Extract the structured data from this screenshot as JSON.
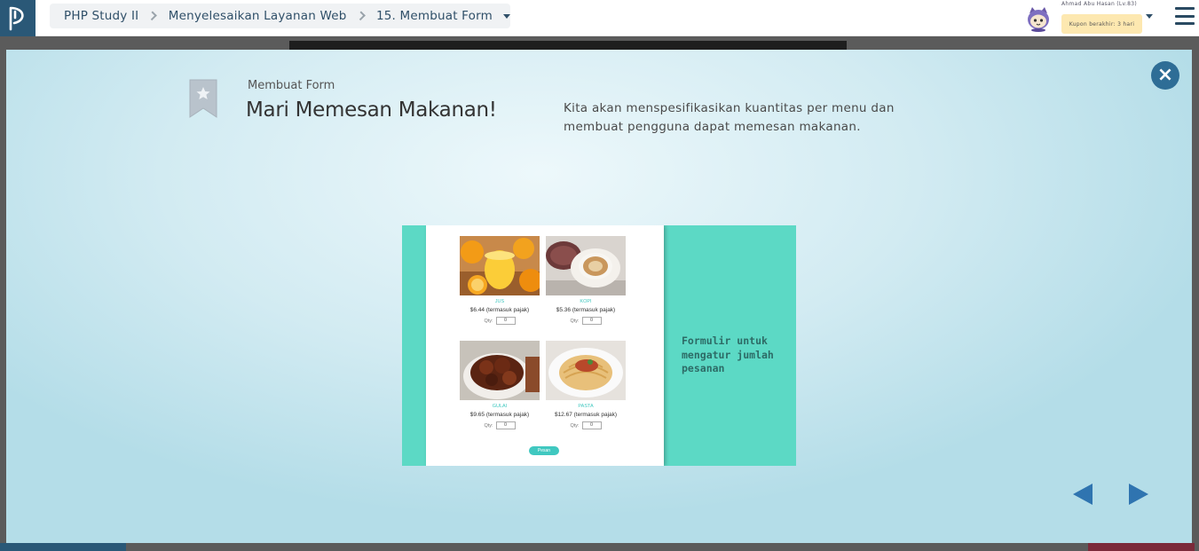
{
  "header": {
    "breadcrumb": [
      "PHP Study II",
      "Menyelesaikan Layanan Web",
      "15. Membuat Form"
    ],
    "user": {
      "name": "Ahmad Abu Hasan (Lv.83)",
      "coupon": "Kupon berakhir: 3 hari"
    }
  },
  "modal": {
    "subtitle": "Membuat Form",
    "title": "Mari Memesan Makanan!",
    "description": "Kita akan menspesifikasikan kuantitas per menu dan membuat pengguna dapat memesan makanan.",
    "close_label": "×",
    "slide": {
      "foods": [
        {
          "name": "JUS",
          "price": "$6.44 (termasuk pajak)",
          "qty_label": "Qty:",
          "qty_value": "0"
        },
        {
          "name": "KOPI",
          "price": "$5.36 (termasuk pajak)",
          "qty_label": "Qty:",
          "qty_value": "0"
        },
        {
          "name": "GULAI",
          "price": "$9.65 (termasuk pajak)",
          "qty_label": "Qty:",
          "qty_value": "0"
        },
        {
          "name": "PASTA",
          "price": "$12.67 (termasuk pajak)",
          "qty_label": "Qty:",
          "qty_value": "0"
        }
      ],
      "order_button": "Pesan",
      "caption": "Formulir untuk mengatur jumlah pesanan"
    }
  },
  "colors": {
    "header_logo_bg": "#2a5877",
    "breadcrumb_text": "#2f4f68",
    "slide_bg": "#5cd9c5",
    "accent_teal": "#40c8c0",
    "nav_arrow": "#2f74b0",
    "close_button": "#2e6d96"
  },
  "icons": {
    "logo": "progate-logo-icon",
    "menu": "hamburger-menu-icon",
    "close": "close-icon",
    "bookmark": "bookmark-star-icon",
    "prev": "prev-arrow-icon",
    "next": "next-arrow-icon"
  }
}
